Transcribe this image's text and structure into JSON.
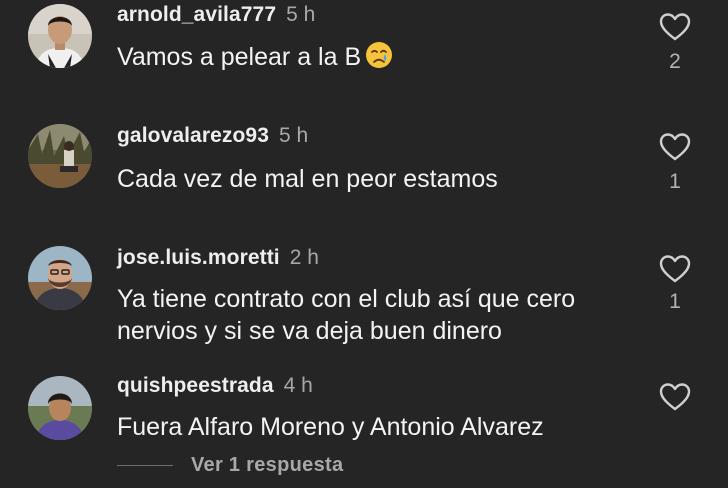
{
  "comments": [
    {
      "username": "arnold_avila777",
      "time": "5 h",
      "text": "Vamos a pelear a la B",
      "emoji": "crying-face-icon",
      "likes": "2"
    },
    {
      "username": "galovalarezo93",
      "time": "5 h",
      "text": "Cada vez de mal en peor estamos",
      "likes": "1"
    },
    {
      "username": "jose.luis.moretti",
      "time": "2 h",
      "text": "Ya tiene contrato con el club así que cero\nnervios y si se va deja buen dinero",
      "likes": "1"
    },
    {
      "username": "quishpeestrada",
      "time": "4 h",
      "text": "Fuera Alfaro Moreno y Antonio Alvarez",
      "likes": ""
    }
  ],
  "replies_link": "Ver 1 respuesta",
  "colors": {
    "background": "#252525",
    "text": "#f3f3f3",
    "secondary": "#a8a8a8",
    "heart_outline": "#cfcfcf"
  }
}
